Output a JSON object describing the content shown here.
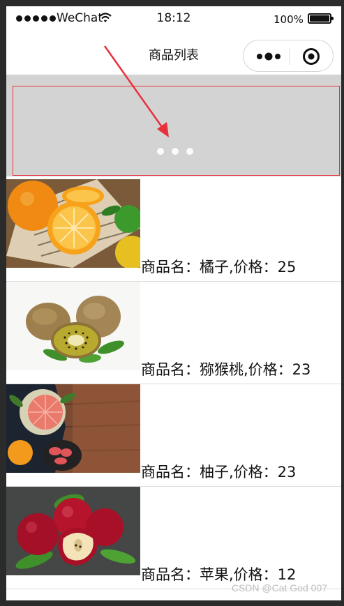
{
  "status_bar": {
    "carrier": "WeChat",
    "time": "18:12",
    "battery": "100%"
  },
  "nav": {
    "title": "商品列表",
    "icons": [
      "more-icon",
      "target-icon"
    ]
  },
  "swiper": {
    "dots": 3,
    "border_color": "#e8313a",
    "background": "#d3d3d3"
  },
  "items": [
    {
      "text": "商品名：橘子,价格：25",
      "image": "orange-photo"
    },
    {
      "text": "商品名：猕猴桃,价格：23",
      "image": "kiwi-photo"
    },
    {
      "text": "商品名：柚子,价格：23",
      "image": "grapefruit-photo"
    },
    {
      "text": "商品名：苹果,价格：12",
      "image": "apple-photo"
    }
  ],
  "watermark": "CSDN @Cat God 007",
  "annotation": {
    "arrow_color": "#e8313a"
  }
}
